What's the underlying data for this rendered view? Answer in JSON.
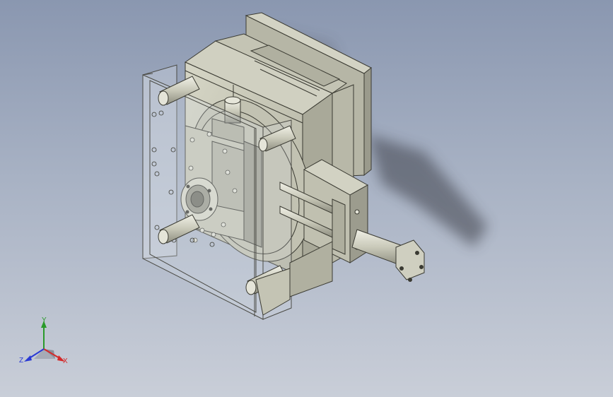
{
  "viewport": {
    "background_top": "#8a97b0",
    "background_bottom": "#c9ced8"
  },
  "model": {
    "part_color": "#c9c9b8",
    "shade_color": "#a8a898",
    "edge_color": "#3a3a32",
    "glass_color": "#d7dde6",
    "shadow_color": "#3c3f4a"
  },
  "triad": {
    "x_label": "X",
    "y_label": "Y",
    "z_label": "Z",
    "x_color": "#d42a2a",
    "y_color": "#2a9a2a",
    "z_color": "#2a3ad4"
  }
}
